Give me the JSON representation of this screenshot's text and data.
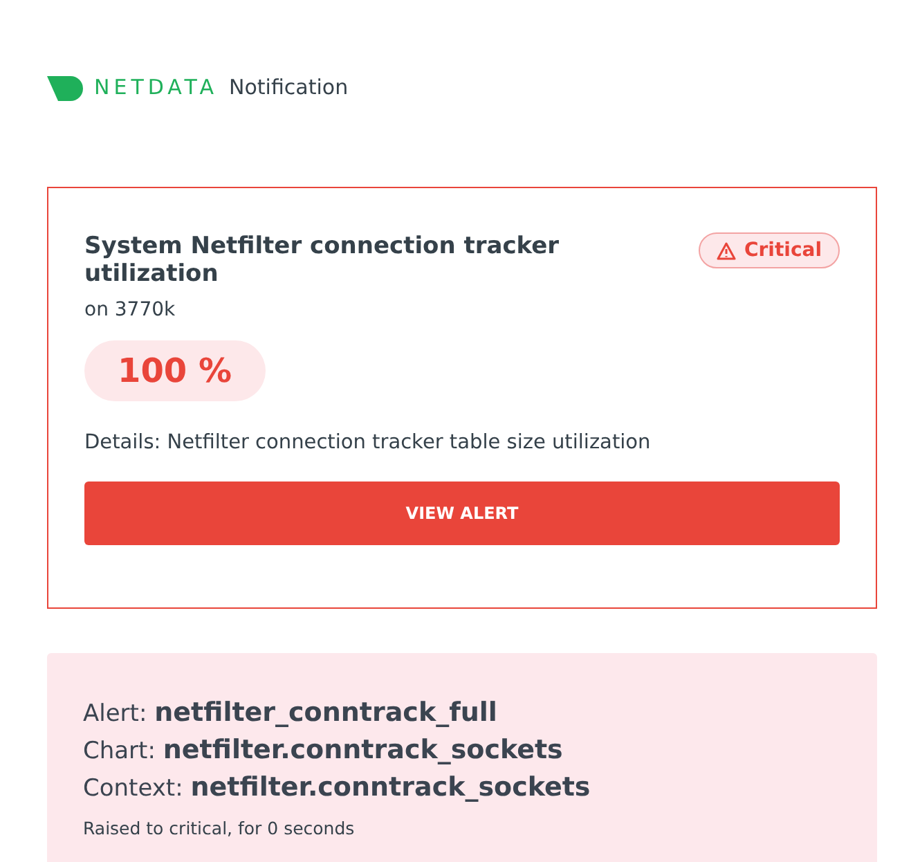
{
  "header": {
    "brand": "NETDATA",
    "title": "Notification"
  },
  "alert": {
    "title": "System Netfilter connection tracker utilization",
    "host": "on 3770k",
    "severity": {
      "kind": "critical",
      "label": "Critical"
    },
    "value": "100 %",
    "details": "Details: Netfilter connection tracker table size utilization",
    "button": "VIEW ALERT"
  },
  "info": {
    "lines": [
      "Alert: **netfilter_conntrack_full**",
      "Chart: **netfilter.conntrack_sockets**",
      "Context: **netfilter.conntrack_sockets**"
    ],
    "note": "Raised to critical, for 0 seconds"
  }
}
